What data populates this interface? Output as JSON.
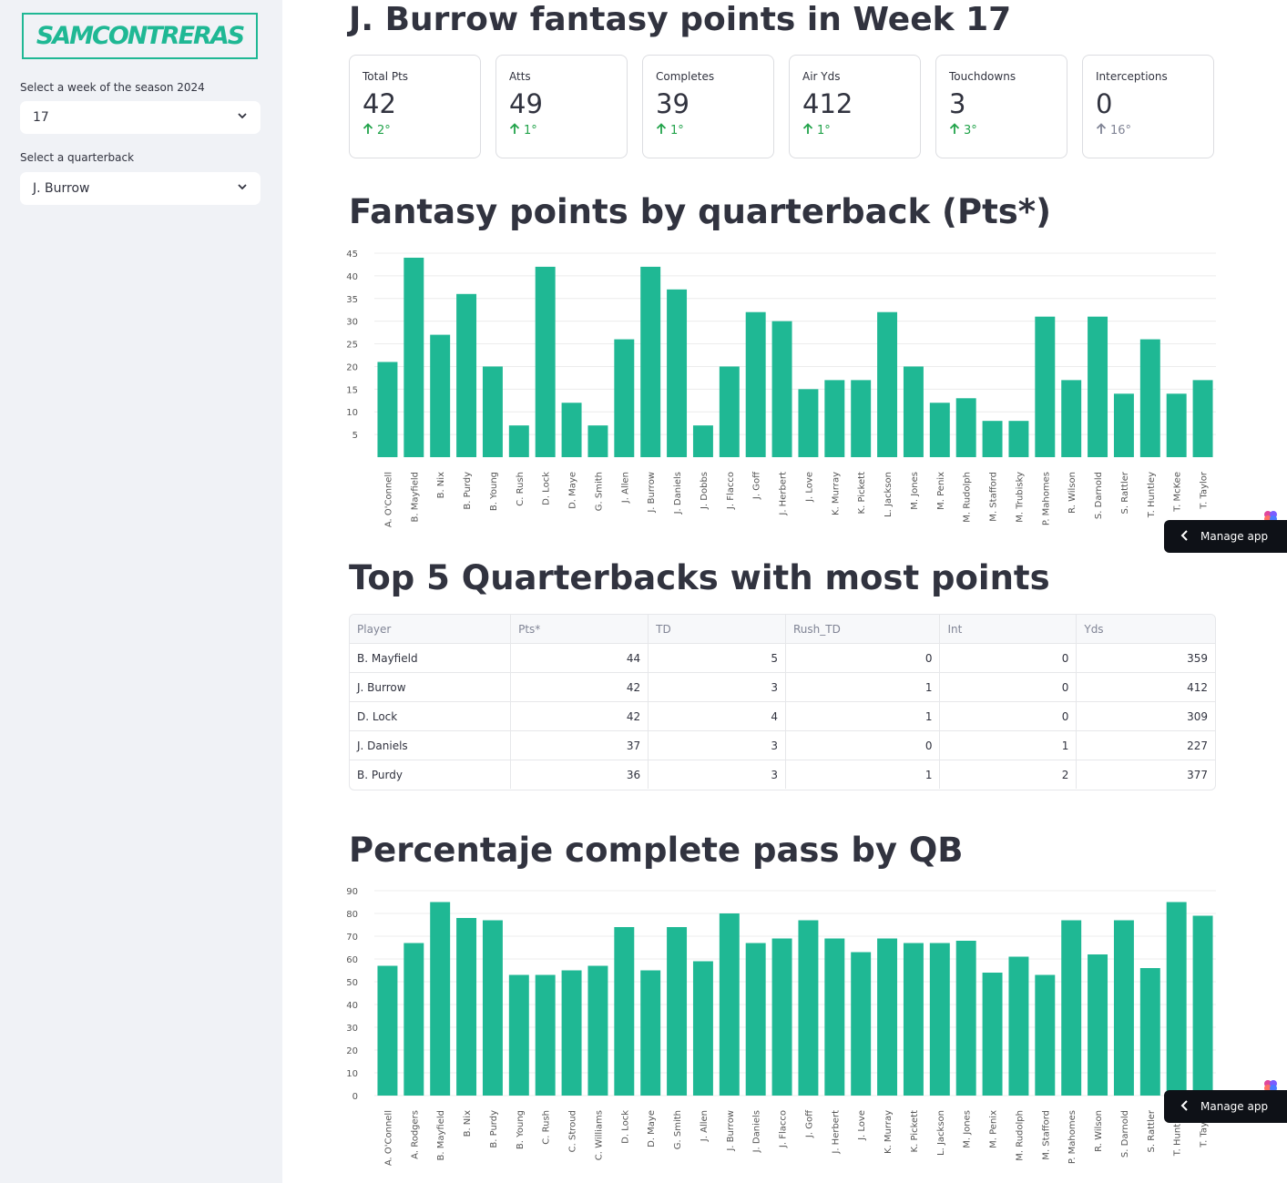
{
  "sidebar": {
    "logo_text": "SAMCONTRERAS",
    "week_label": "Select a week of the season 2024",
    "week_value": "17",
    "qb_label": "Select a quarterback",
    "qb_value": "J. Burrow"
  },
  "main": {
    "title": "J. Burrow fantasy points in Week 17",
    "metrics": [
      {
        "label": "Total Pts",
        "value": "42",
        "delta": "2°",
        "direction": "up"
      },
      {
        "label": "Atts",
        "value": "49",
        "delta": "1°",
        "direction": "up"
      },
      {
        "label": "Completes",
        "value": "39",
        "delta": "1°",
        "direction": "up"
      },
      {
        "label": "Air Yds",
        "value": "412",
        "delta": "1°",
        "direction": "up"
      },
      {
        "label": "Touchdowns",
        "value": "3",
        "delta": "3°",
        "direction": "up"
      },
      {
        "label": "Interceptions",
        "value": "0",
        "delta": "16°",
        "direction": "neutral"
      }
    ],
    "chart1_title": "Fantasy points by quarterback (Pts*)",
    "table_title": "Top 5 Quarterbacks with most points",
    "table": {
      "columns": [
        "Player",
        "Pts*",
        "TD",
        "Rush_TD",
        "Int",
        "Yds"
      ],
      "rows": [
        [
          "B. Mayfield",
          "44",
          "5",
          "0",
          "0",
          "359"
        ],
        [
          "J. Burrow",
          "42",
          "3",
          "1",
          "0",
          "412"
        ],
        [
          "D. Lock",
          "42",
          "4",
          "1",
          "0",
          "309"
        ],
        [
          "J. Daniels",
          "37",
          "3",
          "0",
          "1",
          "227"
        ],
        [
          "B. Purdy",
          "36",
          "3",
          "1",
          "2",
          "377"
        ]
      ]
    },
    "chart2_title": "Percentaje complete pass by QB",
    "manage_label": "Manage app"
  },
  "colors": {
    "bar": "#1fb894",
    "accent": "#1fb894",
    "delta_up": "#21a34a",
    "manage_bg": "#0e1117"
  },
  "chart_data": [
    {
      "type": "bar",
      "title": "",
      "categories": [
        "A. O'Connell",
        "B. Mayfield",
        "B. Nix",
        "B. Purdy",
        "B. Young",
        "C. Rush",
        "D. Lock",
        "D. Maye",
        "G. Smith",
        "J. Allen",
        "J. Burrow",
        "J. Daniels",
        "J. Dobbs",
        "J. Flacco",
        "J. Goff",
        "J. Herbert",
        "J. Love",
        "K. Murray",
        "K. Pickett",
        "L. Jackson",
        "M. Jones",
        "M. Penix",
        "M. Rudolph",
        "M. Stafford",
        "M. Trubisky",
        "P. Mahomes",
        "R. Wilson",
        "S. Darnold",
        "S. Rattler",
        "T. Huntley",
        "T. McKee",
        "T. Taylor"
      ],
      "values": [
        21,
        44,
        27,
        36,
        20,
        7,
        42,
        12,
        7,
        26,
        42,
        37,
        7,
        20,
        32,
        30,
        15,
        17,
        17,
        32,
        20,
        12,
        13,
        8,
        8,
        31,
        17,
        31,
        14,
        26,
        14,
        17
      ],
      "yticks": [
        5,
        10,
        15,
        20,
        25,
        30,
        35,
        40,
        45
      ],
      "ylim": [
        0,
        45
      ],
      "grid": true,
      "xlabel": "",
      "ylabel": ""
    },
    {
      "type": "bar",
      "title": "",
      "categories": [
        "A. O'Connell",
        "A. Rodgers",
        "B. Mayfield",
        "B. Nix",
        "B. Purdy",
        "B. Young",
        "C. Rush",
        "C. Stroud",
        "C. Williams",
        "D. Lock",
        "D. Maye",
        "G. Smith",
        "J. Allen",
        "J. Burrow",
        "J. Daniels",
        "J. Flacco",
        "J. Goff",
        "J. Herbert",
        "J. Love",
        "K. Murray",
        "K. Pickett",
        "L. Jackson",
        "M. Jones",
        "M. Penix",
        "M. Rudolph",
        "M. Stafford",
        "P. Mahomes",
        "R. Wilson",
        "S. Darnold",
        "S. Rattler",
        "T. Huntley",
        "T. Taylor"
      ],
      "values": [
        57,
        67,
        85,
        78,
        77,
        53,
        53,
        55,
        57,
        74,
        55,
        74,
        59,
        80,
        67,
        69,
        77,
        69,
        63,
        69,
        67,
        67,
        68,
        54,
        61,
        53,
        77,
        62,
        77,
        56,
        85,
        79
      ],
      "yticks": [
        0,
        10,
        20,
        30,
        40,
        50,
        60,
        70,
        80,
        90
      ],
      "ylim": [
        0,
        90
      ],
      "grid": true,
      "xlabel": "",
      "ylabel": ""
    }
  ]
}
